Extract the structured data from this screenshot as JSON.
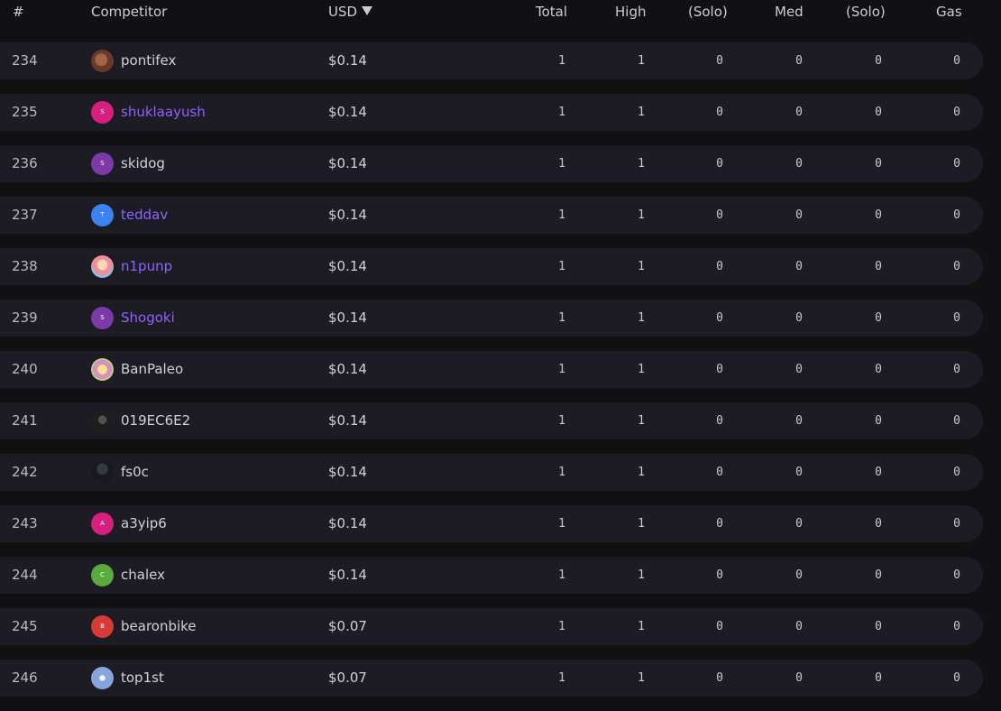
{
  "header": {
    "rank": "#",
    "competitor": "Competitor",
    "usd": "USD",
    "total": "Total",
    "high": "High",
    "solo_high": "(Solo)",
    "med": "Med",
    "solo_med": "(Solo)",
    "gas": "Gas"
  },
  "avatar_colors": {
    "pink": "#d61f7f",
    "purple": "#7c3aa8",
    "blue": "#3d82f0",
    "green": "#58ab3c",
    "red": "#d83a36"
  },
  "rows": [
    {
      "rank": "234",
      "avatar": "photo-brown",
      "initial": "",
      "name": "pontifex",
      "linked": false,
      "usd": "$0.14",
      "total": "1",
      "high": "1",
      "solo_high": "0",
      "med": "0",
      "solo_med": "0",
      "gas": "0"
    },
    {
      "rank": "235",
      "avatar": "pink",
      "initial": "S",
      "name": "shuklaayush",
      "linked": true,
      "usd": "$0.14",
      "total": "1",
      "high": "1",
      "solo_high": "0",
      "med": "0",
      "solo_med": "0",
      "gas": "0"
    },
    {
      "rank": "236",
      "avatar": "purple",
      "initial": "S",
      "name": "skidog",
      "linked": false,
      "usd": "$0.14",
      "total": "1",
      "high": "1",
      "solo_high": "0",
      "med": "0",
      "solo_med": "0",
      "gas": "0"
    },
    {
      "rank": "237",
      "avatar": "blue",
      "initial": "T",
      "name": "teddav",
      "linked": true,
      "usd": "$0.14",
      "total": "1",
      "high": "1",
      "solo_high": "0",
      "med": "0",
      "solo_med": "0",
      "gas": "0"
    },
    {
      "rank": "238",
      "avatar": "photo-anime",
      "initial": "",
      "name": "n1punp",
      "linked": true,
      "usd": "$0.14",
      "total": "1",
      "high": "1",
      "solo_high": "0",
      "med": "0",
      "solo_med": "0",
      "gas": "0"
    },
    {
      "rank": "239",
      "avatar": "purple",
      "initial": "S",
      "name": "Shogoki",
      "linked": true,
      "usd": "$0.14",
      "total": "1",
      "high": "1",
      "solo_high": "0",
      "med": "0",
      "solo_med": "0",
      "gas": "0"
    },
    {
      "rank": "240",
      "avatar": "photo-yellow",
      "initial": "",
      "name": "BanPaleo",
      "linked": false,
      "usd": "$0.14",
      "total": "1",
      "high": "1",
      "solo_high": "0",
      "med": "0",
      "solo_med": "0",
      "gas": "0"
    },
    {
      "rank": "241",
      "avatar": "photo-dark",
      "initial": "",
      "name": "019EC6E2",
      "linked": false,
      "usd": "$0.14",
      "total": "1",
      "high": "1",
      "solo_high": "0",
      "med": "0",
      "solo_med": "0",
      "gas": "0"
    },
    {
      "rank": "242",
      "avatar": "photo-gray",
      "initial": "",
      "name": "fs0c",
      "linked": false,
      "usd": "$0.14",
      "total": "1",
      "high": "1",
      "solo_high": "0",
      "med": "0",
      "solo_med": "0",
      "gas": "0"
    },
    {
      "rank": "243",
      "avatar": "pink",
      "initial": "A",
      "name": "a3yip6",
      "linked": false,
      "usd": "$0.14",
      "total": "1",
      "high": "1",
      "solo_high": "0",
      "med": "0",
      "solo_med": "0",
      "gas": "0"
    },
    {
      "rank": "244",
      "avatar": "green",
      "initial": "C",
      "name": "chalex",
      "linked": false,
      "usd": "$0.14",
      "total": "1",
      "high": "1",
      "solo_high": "0",
      "med": "0",
      "solo_med": "0",
      "gas": "0"
    },
    {
      "rank": "245",
      "avatar": "red",
      "initial": "B",
      "name": "bearonbike",
      "linked": false,
      "usd": "$0.07",
      "total": "1",
      "high": "1",
      "solo_high": "0",
      "med": "0",
      "solo_med": "0",
      "gas": "0"
    },
    {
      "rank": "246",
      "avatar": "photo-blue",
      "initial": "",
      "name": "top1st",
      "linked": false,
      "usd": "$0.07",
      "total": "1",
      "high": "1",
      "solo_high": "0",
      "med": "0",
      "solo_med": "0",
      "gas": "0"
    }
  ]
}
